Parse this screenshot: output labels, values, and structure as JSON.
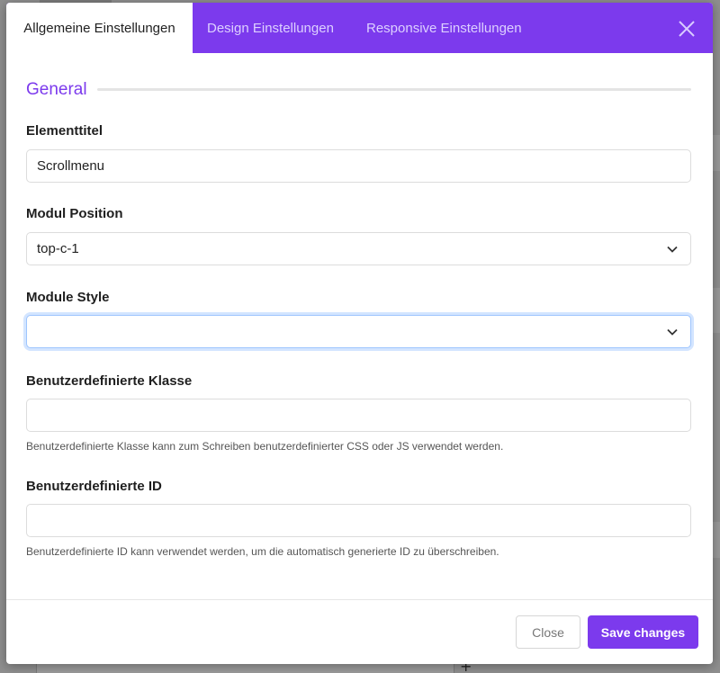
{
  "tabs": [
    {
      "label": "Allgemeine Einstellungen",
      "active": true
    },
    {
      "label": "Design Einstellungen",
      "active": false
    },
    {
      "label": "Responsive Einstellungen",
      "active": false
    }
  ],
  "section": {
    "legend": "General"
  },
  "fields": {
    "element_title": {
      "label": "Elementtitel",
      "value": "Scrollmenu"
    },
    "module_position": {
      "label": "Modul Position",
      "value": "top-c-1"
    },
    "module_style": {
      "label": "Module Style",
      "value": ""
    },
    "custom_class": {
      "label": "Benutzerdefinierte Klasse",
      "value": "",
      "help": "Benutzerdefinierte Klasse kann zum Schreiben benutzerdefinierter CSS oder JS verwendet werden."
    },
    "custom_id": {
      "label": "Benutzerdefinierte ID",
      "value": "",
      "help": "Benutzerdefinierte ID kann verwendet werden, um die automatisch generierte ID zu überschreiben."
    }
  },
  "footer": {
    "close_label": "Close",
    "save_label": "Save changes"
  },
  "icons": {
    "close": "close-icon",
    "chevron": "chevron-down-icon"
  },
  "colors": {
    "accent": "#7c3aed",
    "focus_ring": "#9ec5fe"
  }
}
